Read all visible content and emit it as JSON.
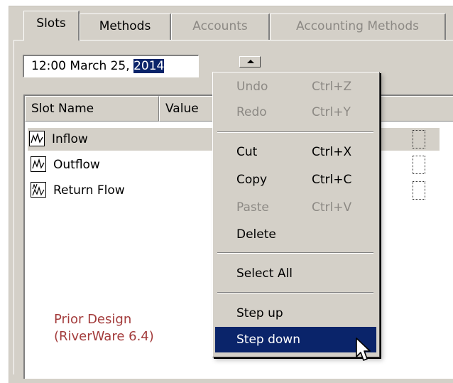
{
  "tabs": [
    {
      "label": "Slots",
      "state": "active"
    },
    {
      "label": "Methods",
      "state": "normal"
    },
    {
      "label": "Accounts",
      "state": "disabled"
    },
    {
      "label": "Accounting Methods",
      "state": "disabled"
    }
  ],
  "date_field": {
    "value_prefix": "12:00 March 25, ",
    "value_selected": "2014"
  },
  "columns": {
    "slot_name": "Slot Name",
    "value": "Value"
  },
  "slots": [
    {
      "name": "Inflow",
      "icon": "series-slot-icon",
      "selected": true
    },
    {
      "name": "Outflow",
      "icon": "series-slot-icon",
      "selected": false
    },
    {
      "name": "Return Flow",
      "icon": "multi-series-slot-icon",
      "selected": false
    }
  ],
  "caption": {
    "line1": "Prior Design",
    "line2": "(RiverWare 6.4)"
  },
  "context_menu": {
    "undo": {
      "label": "Undo",
      "shortcut": "Ctrl+Z",
      "enabled": false
    },
    "redo": {
      "label": "Redo",
      "shortcut": "Ctrl+Y",
      "enabled": false
    },
    "cut": {
      "label": "Cut",
      "shortcut": "Ctrl+X",
      "enabled": true
    },
    "copy": {
      "label": "Copy",
      "shortcut": "Ctrl+C",
      "enabled": true
    },
    "paste": {
      "label": "Paste",
      "shortcut": "Ctrl+V",
      "enabled": false
    },
    "delete": {
      "label": "Delete",
      "enabled": true
    },
    "select_all": {
      "label": "Select All",
      "enabled": true
    },
    "step_up": {
      "label": "Step up",
      "enabled": true
    },
    "step_down": {
      "label": "Step down",
      "enabled": true,
      "highlighted": true
    }
  },
  "colors": {
    "window_bg": "#d4d0c8",
    "selection": "#0a246a",
    "disabled_text": "#8c8984",
    "caption_text": "#a33b3b"
  }
}
